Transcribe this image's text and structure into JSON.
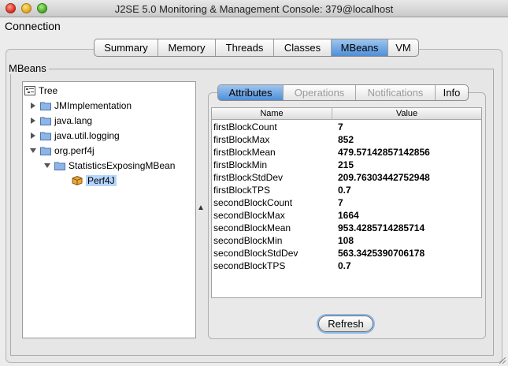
{
  "window": {
    "title": "J2SE 5.0 Monitoring & Management Console: 379@localhost"
  },
  "menu": {
    "items": [
      "Connection"
    ]
  },
  "top_tabs": [
    {
      "label": "Summary",
      "active": false
    },
    {
      "label": "Memory",
      "active": false
    },
    {
      "label": "Threads",
      "active": false
    },
    {
      "label": "Classes",
      "active": false
    },
    {
      "label": "MBeans",
      "active": true
    },
    {
      "label": "VM",
      "active": false
    }
  ],
  "mbeans": {
    "group_label": "MBeans",
    "tree": {
      "root": "Tree",
      "nodes": [
        {
          "label": "JMImplementation",
          "expanded": false
        },
        {
          "label": "java.lang",
          "expanded": false
        },
        {
          "label": "java.util.logging",
          "expanded": false
        },
        {
          "label": "org.perf4j",
          "expanded": true
        },
        {
          "label": "StatisticsExposingMBean",
          "expanded": true
        },
        {
          "label": "Perf4J",
          "selected": true
        }
      ]
    },
    "inner_tabs": [
      {
        "label": "Attributes",
        "active": true,
        "enabled": true
      },
      {
        "label": "Operations",
        "active": false,
        "enabled": false
      },
      {
        "label": "Notifications",
        "active": false,
        "enabled": false
      },
      {
        "label": "Info",
        "active": false,
        "enabled": true
      }
    ],
    "table": {
      "headers": {
        "name": "Name",
        "value": "Value"
      },
      "rows": [
        {
          "name": "firstBlockCount",
          "value": "7"
        },
        {
          "name": "firstBlockMax",
          "value": "852"
        },
        {
          "name": "firstBlockMean",
          "value": "479.57142857142856"
        },
        {
          "name": "firstBlockMin",
          "value": "215"
        },
        {
          "name": "firstBlockStdDev",
          "value": "209.76303442752948"
        },
        {
          "name": "firstBlockTPS",
          "value": "0.7"
        },
        {
          "name": "secondBlockCount",
          "value": "7"
        },
        {
          "name": "secondBlockMax",
          "value": "1664"
        },
        {
          "name": "secondBlockMean",
          "value": "953.4285714285714"
        },
        {
          "name": "secondBlockMin",
          "value": "108"
        },
        {
          "name": "secondBlockStdDev",
          "value": "563.3425390706178"
        },
        {
          "name": "secondBlockTPS",
          "value": "0.7"
        }
      ]
    },
    "refresh_label": "Refresh"
  },
  "colors": {
    "selection": "#b5d5ff",
    "active_tab": "#4f8fd8",
    "disabled_text": "#9a9a9a"
  }
}
